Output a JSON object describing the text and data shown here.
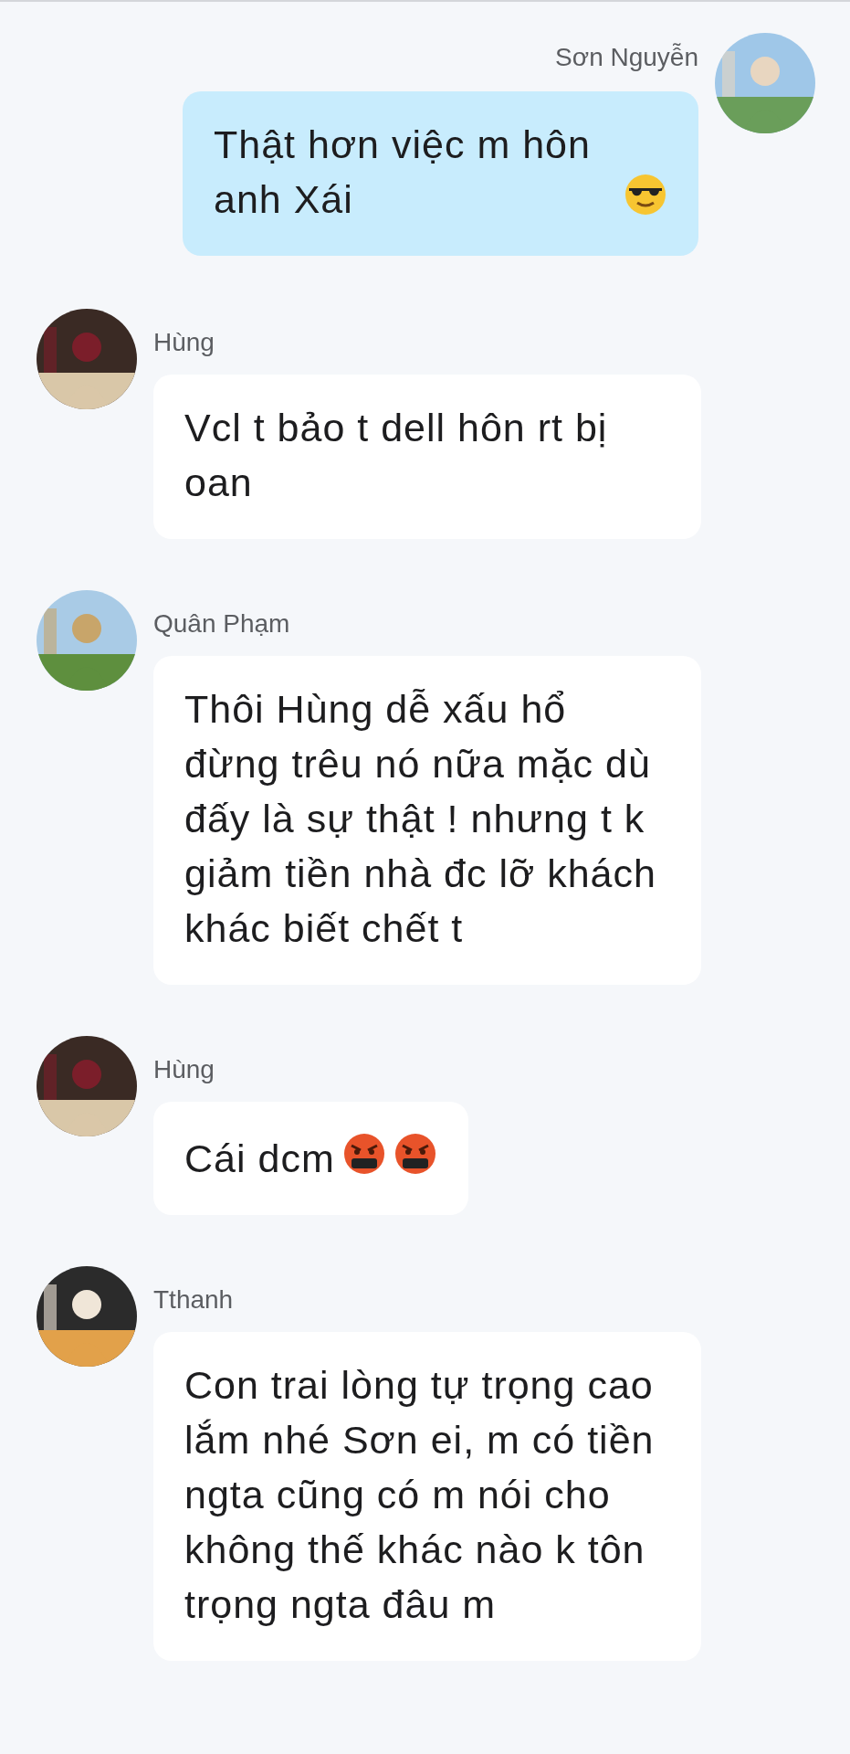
{
  "messages": [
    {
      "sender": "Sơn Nguyễn",
      "kind": "outgoing",
      "text": "Thật hơn việc m hôn anh Xái",
      "emojis": [
        {
          "kind": "cool"
        }
      ]
    },
    {
      "sender": "Hùng",
      "kind": "incoming",
      "text": "Vcl t bảo t dell hôn rt bị oan"
    },
    {
      "sender": "Quân Phạm",
      "kind": "incoming",
      "text": "Thôi Hùng dễ xấu hổ đừng trêu nó nữa mặc dù đấy là sự thật !  nhưng t k giảm tiền nhà đc lỡ khách khác biết chết t"
    },
    {
      "sender": "Hùng",
      "kind": "incoming",
      "text": "Cái dcm",
      "emojis": [
        {
          "kind": "cursing"
        },
        {
          "kind": "cursing"
        }
      ]
    },
    {
      "sender": "Tthanh",
      "kind": "incoming",
      "text": "Con trai lòng tự trọng cao lắm nhé Sơn ei, m có tiền ngta cũng có m nói cho không thế khác nào k tôn trọng ngta đâu m"
    }
  ]
}
